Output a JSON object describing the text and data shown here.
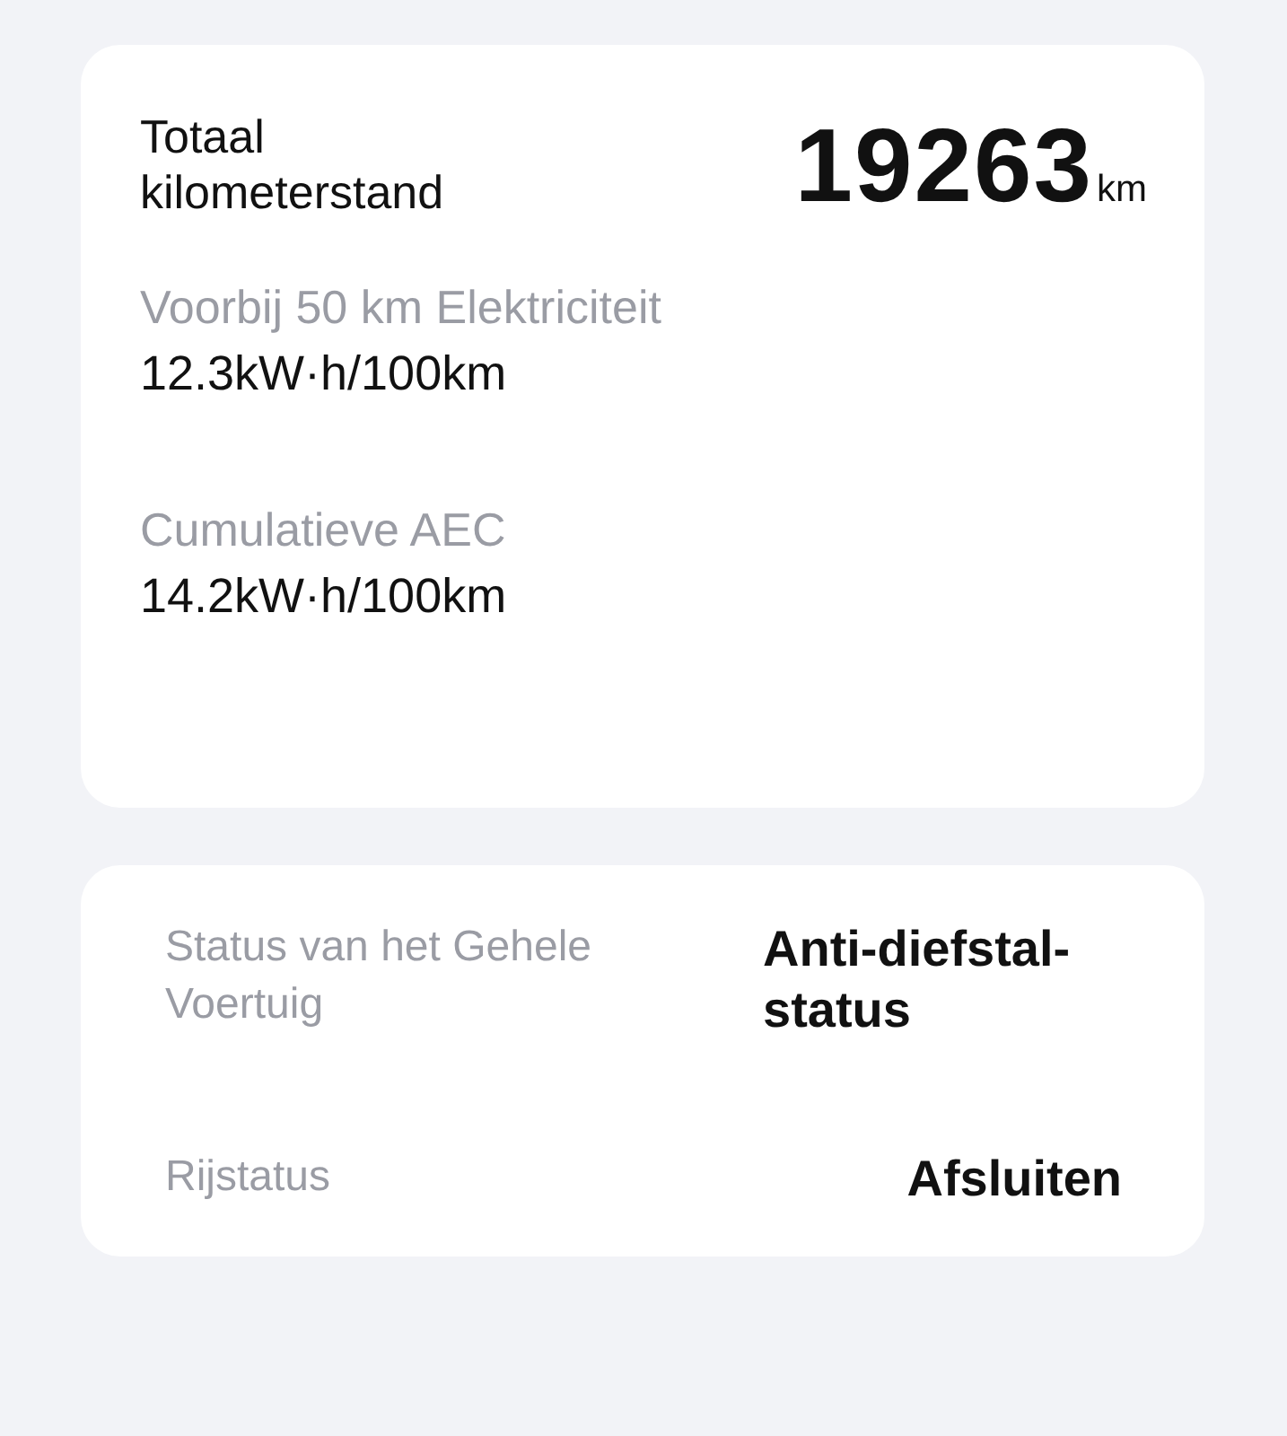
{
  "summary": {
    "odometer_label": "Totaal kilometerstand",
    "odometer_value": "19263",
    "odometer_unit": "km",
    "stats": [
      {
        "label": "Voorbij 50 km Elektriciteit",
        "value": "12.3kW·h/100km"
      },
      {
        "label": "Cumulatieve AEC",
        "value": "14.2kW·h/100km"
      }
    ]
  },
  "status": [
    {
      "label": "Status van het Gehele Voertuig",
      "value": "Anti-diefstal-status"
    },
    {
      "label": "Rijstatus",
      "value": "Afsluiten"
    }
  ]
}
